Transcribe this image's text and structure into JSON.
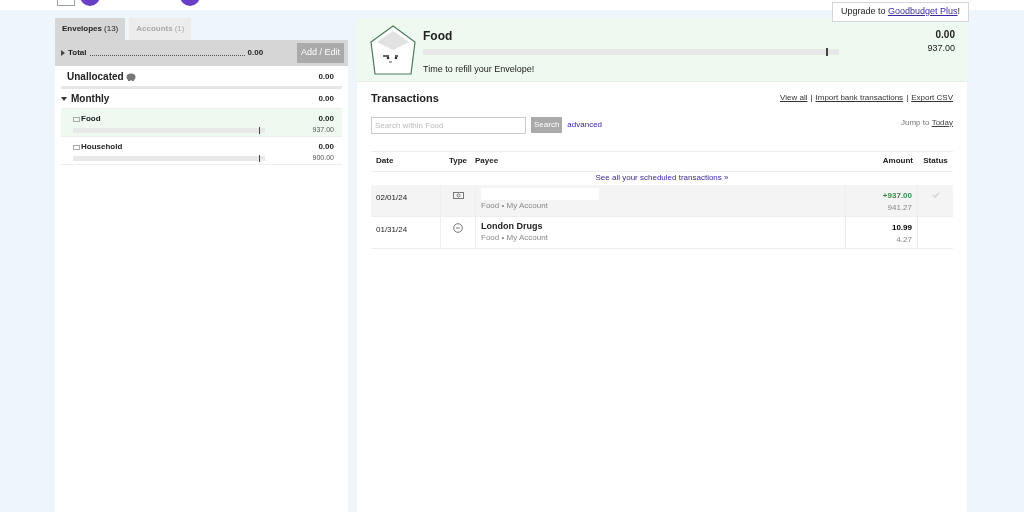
{
  "upgrade_banner": {
    "text": "Upgrade to ",
    "link": "Goodbudget Plus",
    "suffix": "!"
  },
  "tabs": [
    {
      "label": "Envelopes",
      "count": "(13)",
      "selected": true
    },
    {
      "label": "Accounts",
      "count": "(1)",
      "selected": false
    }
  ],
  "total": {
    "label": "Total",
    "amount": "0.00",
    "expanded": false,
    "button": "Add / Edit"
  },
  "unallocated": {
    "label": "Unallocated",
    "amount": "0.00"
  },
  "groups": [
    {
      "name": "Monthly",
      "amount": "0.00",
      "expanded": true,
      "envelopes": [
        {
          "name": "Food",
          "amount": "0.00",
          "budget": "937.00",
          "level": 0,
          "selected": true
        },
        {
          "name": "Household",
          "amount": "0.00",
          "budget": "900.00",
          "level": 0,
          "selected": false
        }
      ]
    }
  ],
  "envelope_header": {
    "name": "Food",
    "message": "Time to refill your Envelope!",
    "amount": "0.00",
    "budget": "937.00",
    "level": 0
  },
  "transactions": {
    "title": "Transactions",
    "links": [
      "View all",
      "Import bank transactions",
      "Export CSV"
    ],
    "link_separator": "|",
    "search_placeholder": "Search within Food",
    "search_button": "Search",
    "advanced": "advanced",
    "jump_label": "Jump to ",
    "jump_link": "Today",
    "columns": [
      "Date",
      "Type",
      "Payee",
      "Amount",
      "Status"
    ],
    "scheduled_link": "See all your scheduled transactions »",
    "rows": [
      {
        "date": "02/01/24",
        "kind": "income",
        "details": "Food • My Account",
        "amount": "+937.00",
        "balance": "941.27",
        "cleared": true
      },
      {
        "date": "01/31/24",
        "kind": "expense",
        "payee": "London Drugs",
        "details": "Food • My Account",
        "amount": "10.99",
        "balance": "4.27",
        "cleared": false
      }
    ]
  }
}
